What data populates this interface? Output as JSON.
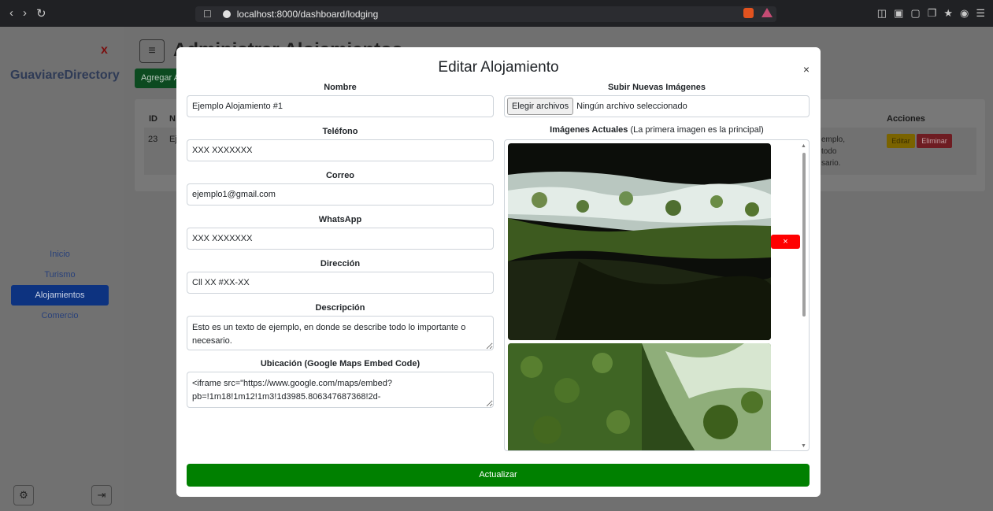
{
  "browser": {
    "url": "localhost:8000/dashboard/lodging"
  },
  "sidebar": {
    "brand": "GuaviareDirectory",
    "close_label": "x",
    "items": [
      {
        "label": "Inicio"
      },
      {
        "label": "Turismo"
      },
      {
        "label": "Alojamientos"
      },
      {
        "label": "Comercio"
      }
    ],
    "active": "Alojamientos"
  },
  "background": {
    "page_title": "Administrar Alojamientos",
    "add_button": "Agregar A",
    "table": {
      "headers": {
        "id": "ID",
        "name": "N",
        "actions": "Acciones"
      },
      "row": {
        "id": "23",
        "name": "Ej",
        "description_fragment": "emplo, todo sario."
      },
      "edit_label": "Editar",
      "delete_label": "Eliminar"
    }
  },
  "modal": {
    "title": "Editar Alojamiento",
    "close_label": "×",
    "fields": {
      "nombre": {
        "label": "Nombre",
        "value": "Ejemplo Alojamiento #1"
      },
      "telefono": {
        "label": "Teléfono",
        "value": "XXX XXXXXXX"
      },
      "correo": {
        "label": "Correo",
        "value": "ejemplo1@gmail.com"
      },
      "whatsapp": {
        "label": "WhatsApp",
        "value": "XXX XXXXXXX"
      },
      "direccion": {
        "label": "Dirección",
        "value": "Cll XX #XX-XX"
      },
      "descripcion": {
        "label": "Descripción",
        "value": "Esto es un texto de ejemplo, en donde se describe todo lo importante o necesario."
      },
      "ubicacion": {
        "label": "Ubicación (Google Maps Embed Code)",
        "value": "<iframe src=\"https://www.google.com/maps/embed?pb=!1m18!1m12!1m3!1d3985.806347687368!2d-"
      }
    },
    "upload": {
      "label": "Subir Nuevas Imágenes",
      "button": "Elegir archivos",
      "status": "Ningún archivo seleccionado"
    },
    "current_images": {
      "label_bold": "Imágenes Actuales",
      "label_note": " (La primera imagen es la principal)",
      "delete_icon": "×"
    },
    "submit_label": "Actualizar"
  }
}
